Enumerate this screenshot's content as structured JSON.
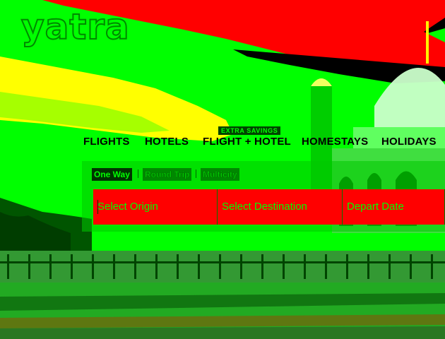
{
  "brand": {
    "logo_text": "yatra"
  },
  "nav": {
    "items": [
      {
        "label": "FLIGHTS"
      },
      {
        "label": "HOTELS"
      },
      {
        "label": "FLIGHT + HOTEL",
        "badge": "EXTRA SAVINGS"
      },
      {
        "label": "HOMESTAYS"
      },
      {
        "label": "HOLIDAYS"
      }
    ]
  },
  "search": {
    "trip_types": [
      {
        "label": "One Way",
        "active": true
      },
      {
        "label": "Round Trip",
        "active": false
      },
      {
        "label": "Multicity",
        "active": false
      }
    ],
    "fields": {
      "origin_placeholder": "Select Origin",
      "destination_placeholder": "Select Destination",
      "depart_placeholder": "Depart Date"
    }
  },
  "colors": {
    "primary_red": "#ff0000",
    "primary_green": "#00ff00",
    "accent_yellow": "#ffff00",
    "dark_green": "#003300"
  }
}
